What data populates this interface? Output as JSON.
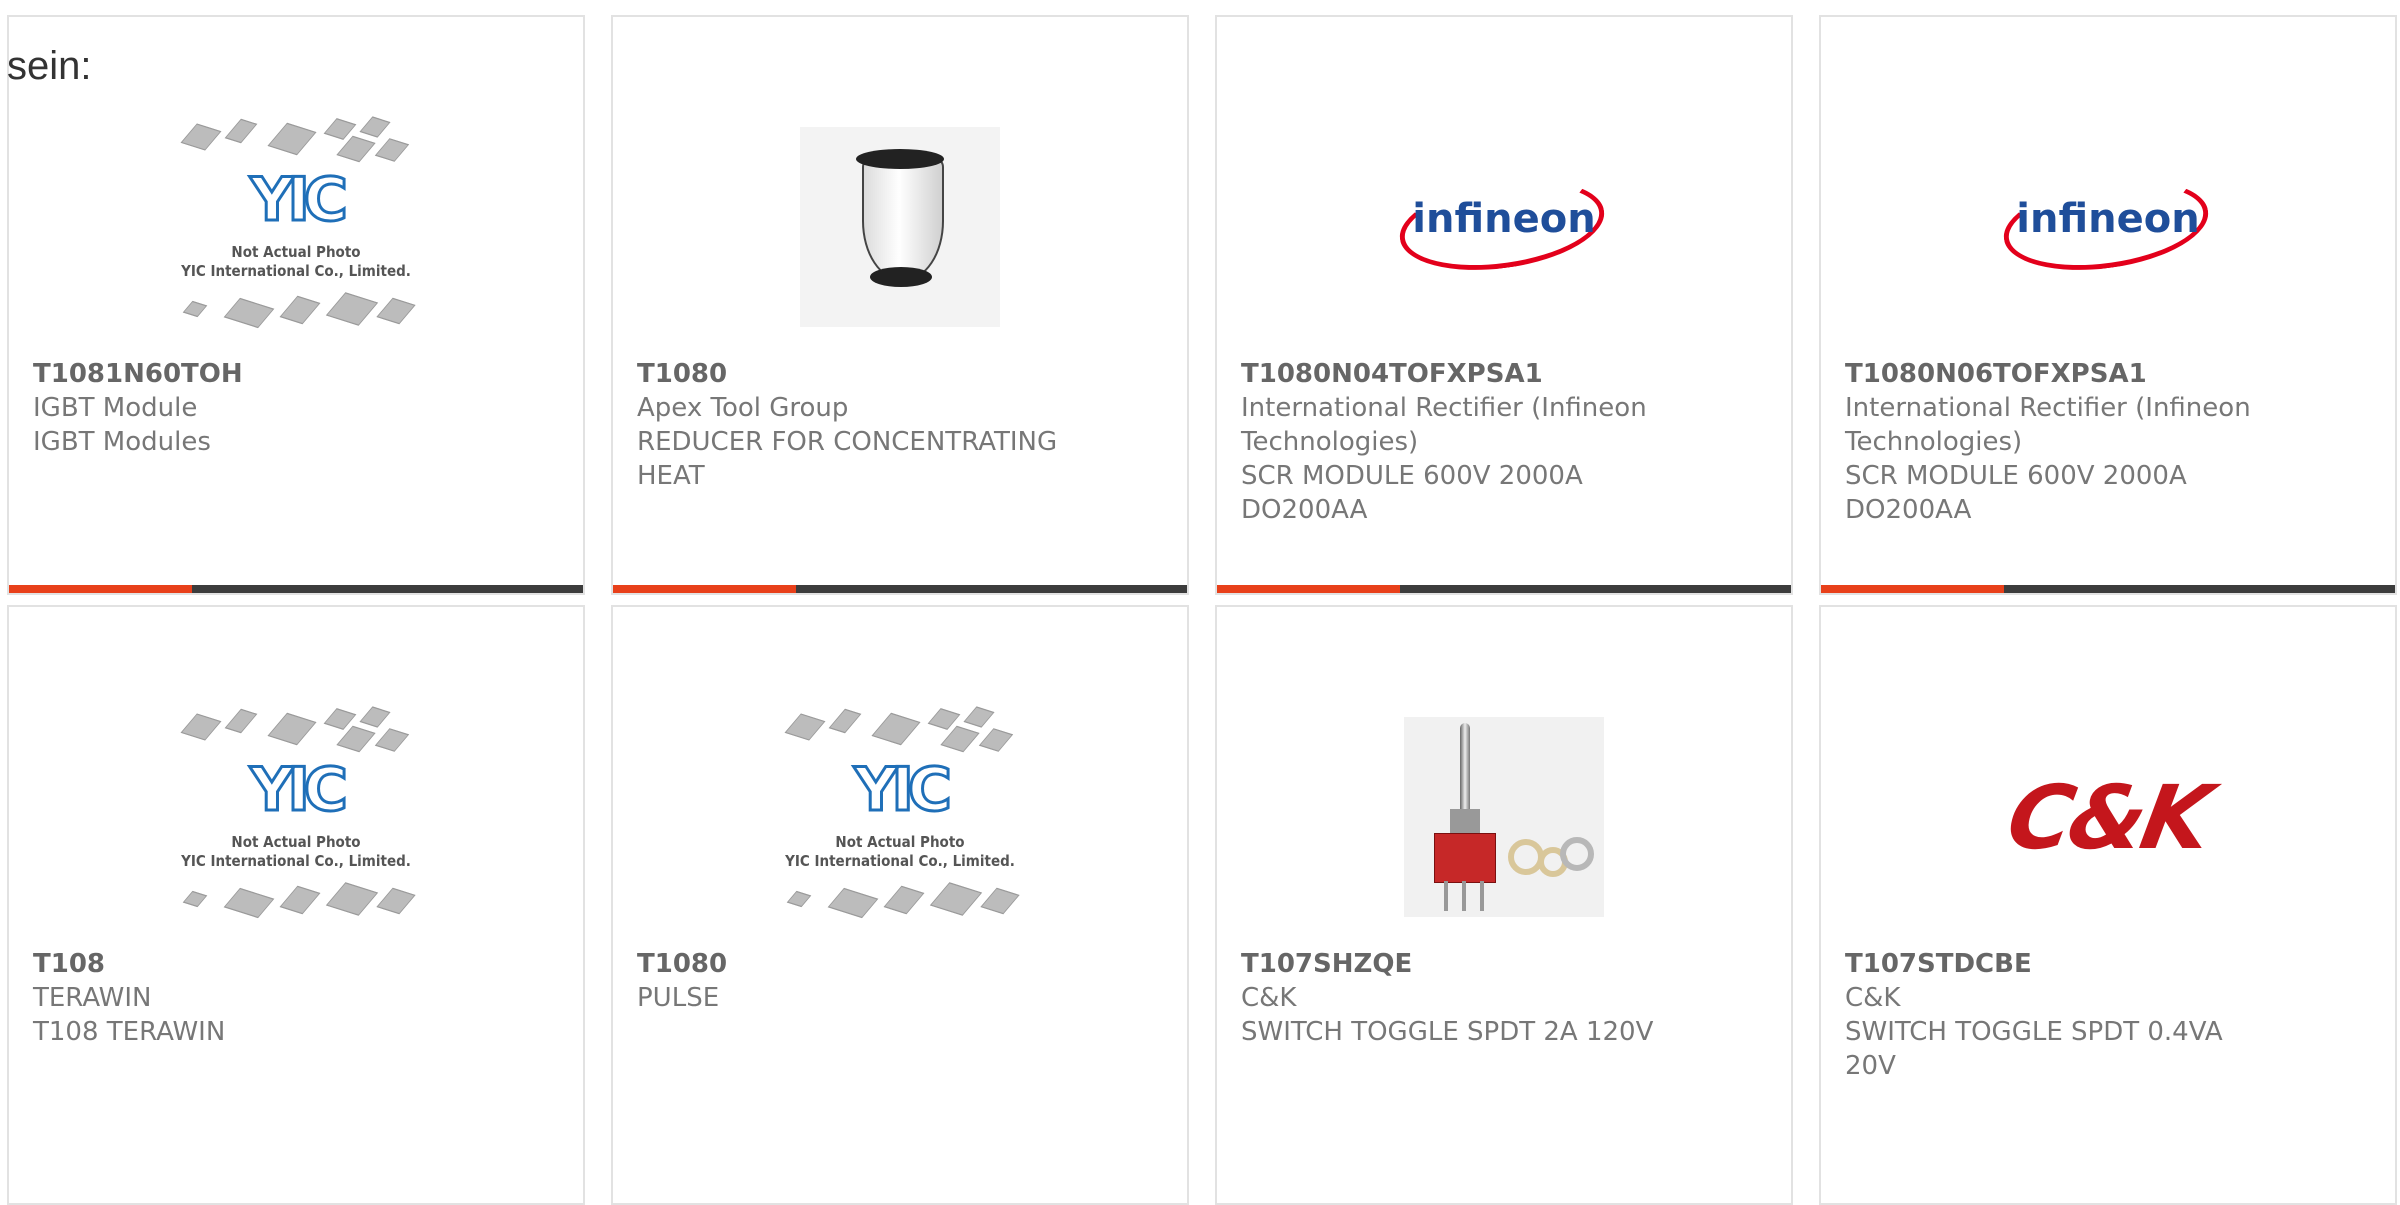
{
  "header": {
    "fragment": "sein:"
  },
  "products": [
    {
      "part_number": "T1081N60TOH",
      "lines": [
        "IGBT Module",
        "IGBT Modules"
      ],
      "image": "yic-placeholder",
      "image_text": [
        "Not Actual Photo",
        "YIC International Co., Limited."
      ]
    },
    {
      "part_number": "T1080",
      "lines": [
        "Apex Tool Group",
        "REDUCER FOR CONCENTRATING",
        "HEAT"
      ],
      "image": "reducer-nozzle-photo"
    },
    {
      "part_number": "T1080N04TOFXPSA1",
      "lines": [
        "International Rectifier (Infineon",
        "Technologies)",
        "SCR MODULE 600V 2000A",
        "DO200AA"
      ],
      "image": "infineon-logo",
      "logo_text": "infineon"
    },
    {
      "part_number": "T1080N06TOFXPSA1",
      "lines": [
        "International Rectifier (Infineon",
        "Technologies)",
        "SCR MODULE 600V 2000A",
        "DO200AA"
      ],
      "image": "infineon-logo",
      "logo_text": "infineon"
    },
    {
      "part_number": "T108",
      "lines": [
        "TERAWIN",
        "T108 TERAWIN"
      ],
      "image": "yic-placeholder",
      "image_text": [
        "Not Actual Photo",
        "YIC International Co., Limited."
      ]
    },
    {
      "part_number": "T1080",
      "lines": [
        "PULSE"
      ],
      "image": "yic-placeholder",
      "image_text": [
        "Not Actual Photo",
        "YIC International Co., Limited."
      ]
    },
    {
      "part_number": "T107SHZQE",
      "lines": [
        "C&K",
        "SWITCH TOGGLE SPDT 2A 120V"
      ],
      "image": "toggle-switch-photo"
    },
    {
      "part_number": "T107STDCBE",
      "lines": [
        "C&K",
        "SWITCH TOGGLE SPDT 0.4VA",
        "20V"
      ],
      "image": "ck-logo",
      "logo_text": "C&K"
    }
  ],
  "colors": {
    "accent": "#e8401a",
    "bar": "#3c3c3c",
    "border": "#e2e2e2",
    "text": "#777777",
    "infineon_red": "#e3001b",
    "infineon_blue": "#1f4e9a",
    "ck_red": "#c4161c",
    "yic_blue": "#1f6fb8"
  }
}
